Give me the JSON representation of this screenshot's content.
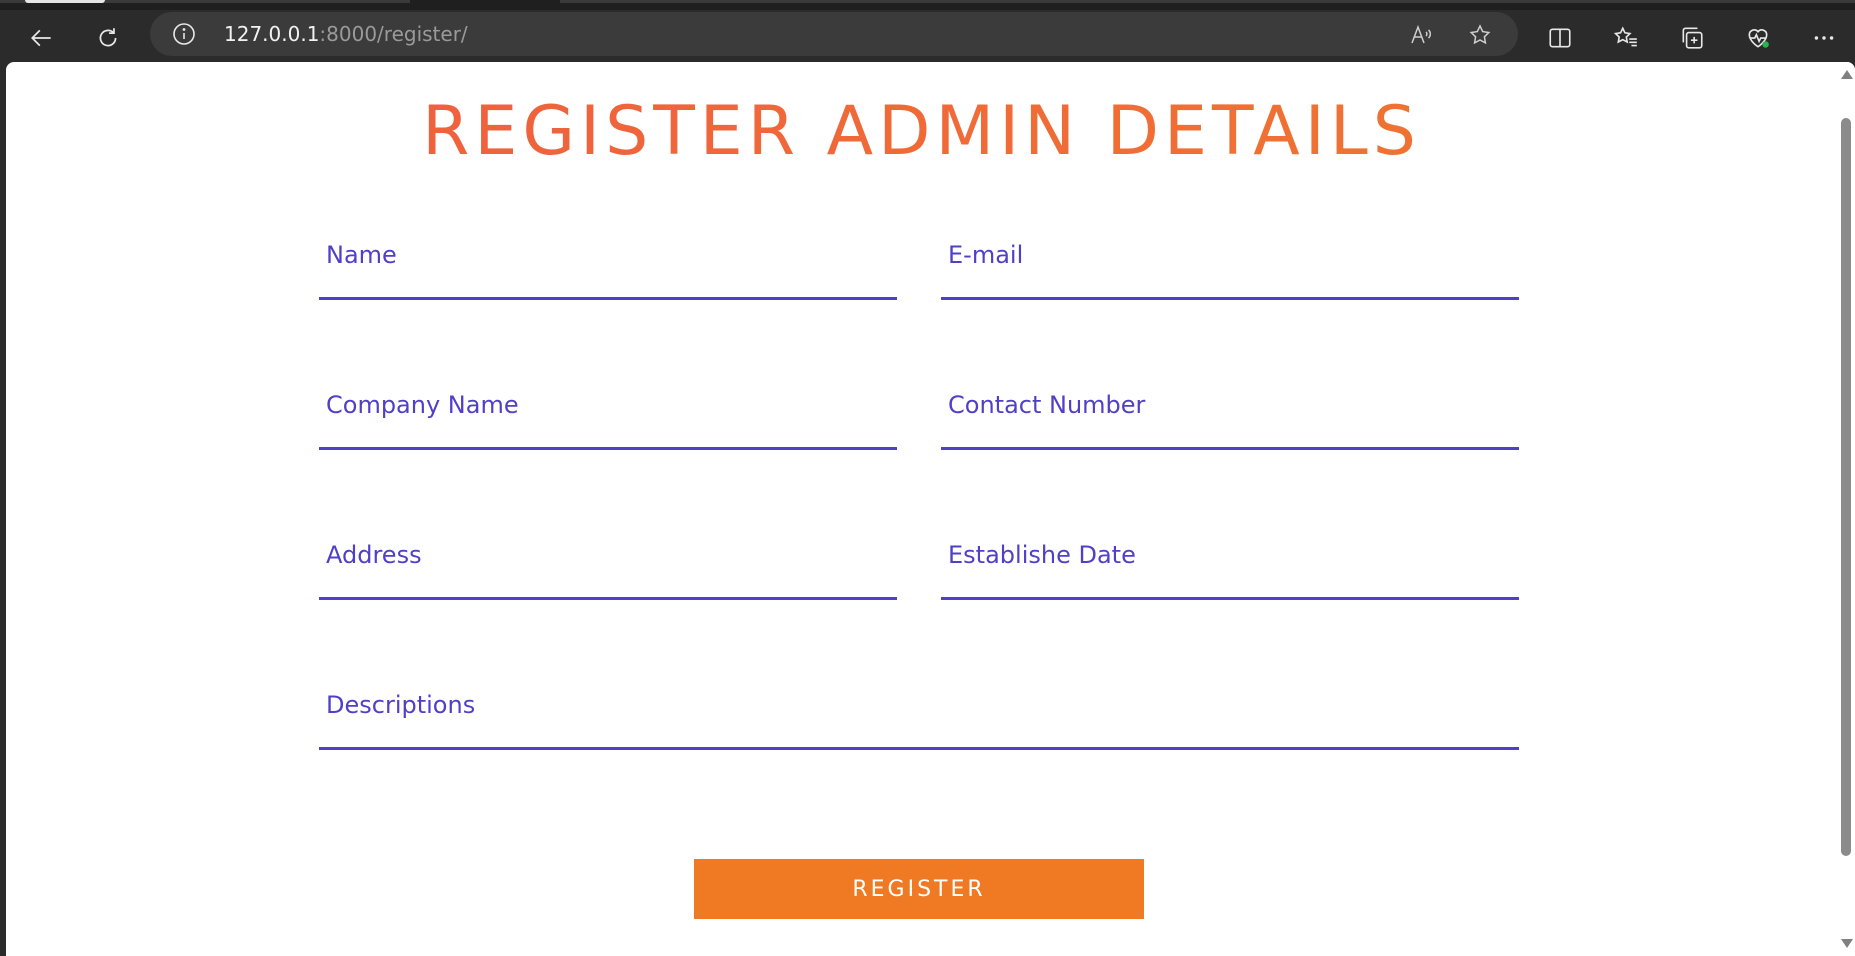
{
  "browser": {
    "url_host": "127.0.0.1",
    "url_rest": ":8000/register/"
  },
  "page": {
    "title": "REGISTER ADMIN DETAILS",
    "fields": {
      "name": "Name",
      "email": "E-mail",
      "company_name": "Company Name",
      "contact_number": "Contact Number",
      "address": "Address",
      "establishe_date": "Establishe Date",
      "descriptions": "Descriptions"
    },
    "register_label": "REGISTER"
  },
  "colors": {
    "accent_purple": "#4f3fc9",
    "title_orange_start": "#ef5a42",
    "title_orange_end": "#f07a2e",
    "button_orange": "#f07a24"
  }
}
